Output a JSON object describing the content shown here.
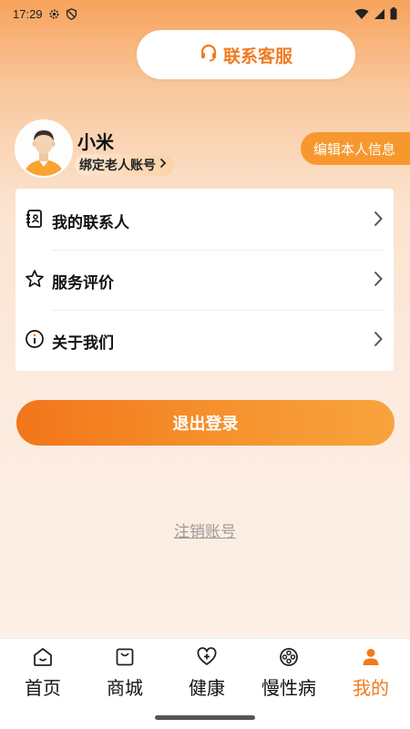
{
  "status_bar": {
    "time": "17:29"
  },
  "service": {
    "label": "联系客服"
  },
  "profile": {
    "name": "小米",
    "bind_label": "绑定老人账号",
    "edit_label": "编辑本人信息"
  },
  "menu": {
    "items": [
      {
        "label": "我的联系人",
        "icon": "contacts-book-icon"
      },
      {
        "label": "服务评价",
        "icon": "star-icon"
      },
      {
        "label": "关于我们",
        "icon": "info-icon"
      }
    ]
  },
  "actions": {
    "logout_label": "退出登录",
    "cancel_account_label": "注销账号"
  },
  "nav": {
    "items": [
      {
        "label": "首页",
        "icon": "home-icon",
        "active": false
      },
      {
        "label": "商城",
        "icon": "shopping-bag-icon",
        "active": false
      },
      {
        "label": "健康",
        "icon": "heart-plus-icon",
        "active": false
      },
      {
        "label": "慢性病",
        "icon": "film-reel-icon",
        "active": false
      },
      {
        "label": "我的",
        "icon": "user-icon",
        "active": true
      }
    ]
  },
  "colors": {
    "accent": "#f07a1e",
    "edit_button": "#f7982e",
    "divider": "#eeeeee"
  }
}
